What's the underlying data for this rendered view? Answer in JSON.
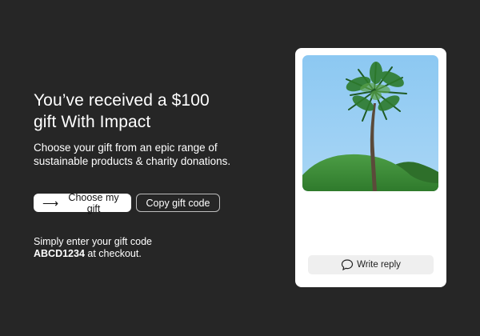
{
  "hero": {
    "headline_line1": "You’ve received a $100",
    "headline_line2": "gift With Impact",
    "subtext_line1": "Choose your gift from an epic range of",
    "subtext_line2": "sustainable products & charity donations."
  },
  "actions": {
    "choose_label": "Choose my gift",
    "copy_label": "Copy gift code"
  },
  "code_info": {
    "line1": "Simply enter your gift code",
    "code": "ABCD1234",
    "line2_suffix": " at checkout."
  },
  "card": {
    "reply_label": "Write reply"
  },
  "icons": {
    "arrow": "arrow-right-icon",
    "reply": "speech-bubble-icon"
  },
  "colors": {
    "background": "#262626",
    "sky": "#8cc8f2",
    "hill": "#3f8f39",
    "card": "#ffffff"
  }
}
